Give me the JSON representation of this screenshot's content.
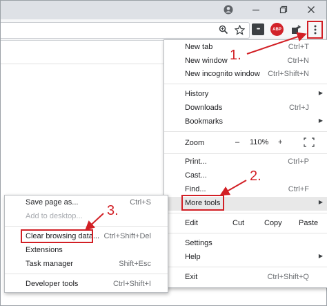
{
  "window": {
    "icons": [
      "account-icon",
      "minimize-icon",
      "restore-icon",
      "close-icon"
    ]
  },
  "toolbar": {
    "zoom_icon": "magnifier-zoom-icon",
    "bookmark_icon": "star-icon",
    "ext1_label": "•••",
    "abp_label": "ABP",
    "share_icon": "share-icon",
    "menu_icon": "vertical-dots-icon"
  },
  "menu": {
    "new_tab": {
      "label": "New tab",
      "shortcut": "Ctrl+T"
    },
    "new_window": {
      "label": "New window",
      "shortcut": "Ctrl+N"
    },
    "new_incognito": {
      "label": "New incognito window",
      "shortcut": "Ctrl+Shift+N"
    },
    "history": {
      "label": "History"
    },
    "downloads": {
      "label": "Downloads",
      "shortcut": "Ctrl+J"
    },
    "bookmarks": {
      "label": "Bookmarks"
    },
    "zoom": {
      "label": "Zoom",
      "minus": "–",
      "value": "110%",
      "plus": "+"
    },
    "print": {
      "label": "Print...",
      "shortcut": "Ctrl+P"
    },
    "cast": {
      "label": "Cast..."
    },
    "find": {
      "label": "Find...",
      "shortcut": "Ctrl+F"
    },
    "more_tools": {
      "label": "More tools"
    },
    "edit": {
      "label": "Edit",
      "cut": "Cut",
      "copy": "Copy",
      "paste": "Paste"
    },
    "settings": {
      "label": "Settings"
    },
    "help": {
      "label": "Help"
    },
    "exit": {
      "label": "Exit",
      "shortcut": "Ctrl+Shift+Q"
    }
  },
  "submenu": {
    "save_page": {
      "label": "Save page as...",
      "shortcut": "Ctrl+S"
    },
    "add_desktop": {
      "label": "Add to desktop..."
    },
    "clear_browsing": {
      "label": "Clear browsing data...",
      "shortcut": "Ctrl+Shift+Del"
    },
    "extensions": {
      "label": "Extensions"
    },
    "task_manager": {
      "label": "Task manager",
      "shortcut": "Shift+Esc"
    },
    "developer_tools": {
      "label": "Developer tools",
      "shortcut": "Ctrl+Shift+I"
    }
  },
  "annotations": {
    "step1": "1.",
    "step2": "2.",
    "step3": "3.",
    "color": "#d21f25"
  }
}
